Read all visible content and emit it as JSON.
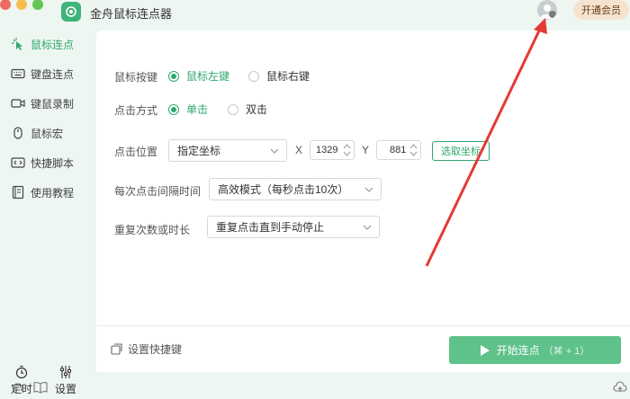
{
  "app": {
    "title": "金舟鼠标连点器"
  },
  "header": {
    "vip_label": "开通会员"
  },
  "sidebar": {
    "items": [
      {
        "label": "鼠标连点",
        "icon": "cursor-click-icon",
        "active": true
      },
      {
        "label": "键盘连点",
        "icon": "keyboard-icon",
        "active": false
      },
      {
        "label": "键鼠录制",
        "icon": "record-icon",
        "active": false
      },
      {
        "label": "鼠标宏",
        "icon": "mouse-icon",
        "active": false
      },
      {
        "label": "快捷脚本",
        "icon": "code-icon",
        "active": false
      },
      {
        "label": "使用教程",
        "icon": "book-icon",
        "active": false
      }
    ],
    "timer_label": "定时",
    "settings_label": "设置"
  },
  "form": {
    "mouse_button": {
      "label": "鼠标按键",
      "options": [
        "鼠标左键",
        "鼠标右键"
      ],
      "selected": "鼠标左键"
    },
    "click_mode": {
      "label": "点击方式",
      "options": [
        "单击",
        "双击"
      ],
      "selected": "单击"
    },
    "click_position": {
      "label": "点击位置",
      "select_value": "指定坐标",
      "x_label": "X",
      "x_value": "1329",
      "y_label": "Y",
      "y_value": "881",
      "pick_label": "选取坐标"
    },
    "interval": {
      "label": "每次点击间隔时间",
      "select_value": "高效模式（每秒点击10次）"
    },
    "repeat": {
      "label": "重复次数或时长",
      "select_value": "重复点击直到手动停止"
    }
  },
  "footer": {
    "shortcut_label": "设置快捷键",
    "start_label": "开始连点",
    "start_hint": "（⌘ + 1）"
  },
  "colors": {
    "accent": "#2fa86d",
    "start_button": "#5fc28b",
    "annotation_arrow": "#e53935"
  }
}
